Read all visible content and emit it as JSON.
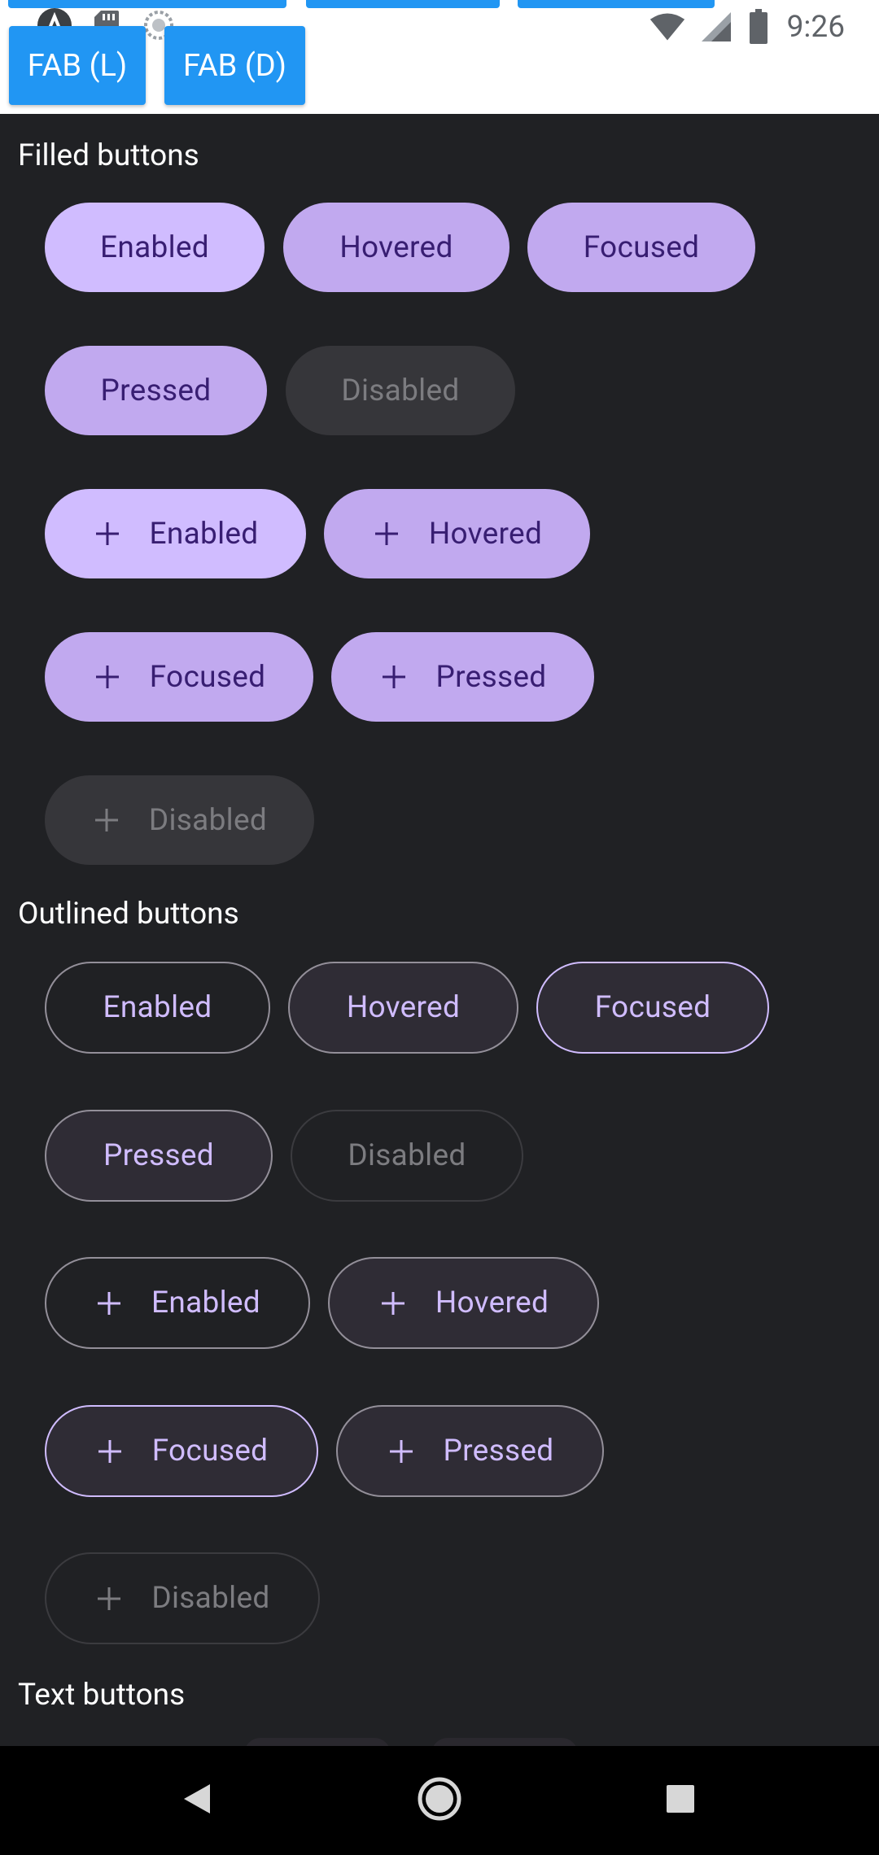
{
  "status_bar": {
    "time": "9:26",
    "left_icons": [
      "app-a-icon",
      "sd-card-icon",
      "sync-icon"
    ],
    "right_icons": [
      "wifi-icon",
      "cell-signal-icon",
      "battery-icon"
    ]
  },
  "top_actions": {
    "fab_light_label": "FAB (L)",
    "fab_dark_label": "FAB (D)"
  },
  "filled_section": {
    "title": "Filled buttons",
    "buttons": [
      {
        "label": "Enabled",
        "icon": null,
        "state": "enabled"
      },
      {
        "label": "Hovered",
        "icon": null,
        "state": "hovered"
      },
      {
        "label": "Focused",
        "icon": null,
        "state": "focused"
      },
      {
        "label": "Pressed",
        "icon": null,
        "state": "pressed"
      },
      {
        "label": "Disabled",
        "icon": null,
        "state": "disabled"
      },
      {
        "label": "Enabled",
        "icon": "plus-icon",
        "state": "enabled"
      },
      {
        "label": "Hovered",
        "icon": "plus-icon",
        "state": "hovered"
      },
      {
        "label": "Focused",
        "icon": "plus-icon",
        "state": "focused"
      },
      {
        "label": "Pressed",
        "icon": "plus-icon",
        "state": "pressed"
      },
      {
        "label": "Disabled",
        "icon": "plus-icon",
        "state": "disabled"
      }
    ]
  },
  "outlined_section": {
    "title": "Outlined buttons",
    "buttons": [
      {
        "label": "Enabled",
        "icon": null,
        "state": "enabled"
      },
      {
        "label": "Hovered",
        "icon": null,
        "state": "hovered"
      },
      {
        "label": "Focused",
        "icon": null,
        "state": "focused"
      },
      {
        "label": "Pressed",
        "icon": null,
        "state": "pressed"
      },
      {
        "label": "Disabled",
        "icon": null,
        "state": "disabled"
      },
      {
        "label": "Enabled",
        "icon": "plus-icon",
        "state": "enabled"
      },
      {
        "label": "Hovered",
        "icon": "plus-icon",
        "state": "hovered"
      },
      {
        "label": "Focused",
        "icon": "plus-icon",
        "state": "focused"
      },
      {
        "label": "Pressed",
        "icon": "plus-icon",
        "state": "pressed"
      },
      {
        "label": "Disabled",
        "icon": "plus-icon",
        "state": "disabled"
      }
    ]
  },
  "text_section": {
    "title": "Text buttons"
  },
  "nav_bar": {
    "icons": [
      "back-icon",
      "home-icon",
      "recents-icon"
    ]
  },
  "colors": {
    "accent_blue": "#2196f3",
    "background_dark": "#202124",
    "primary": "#d0bcff",
    "on_primary": "#381e72",
    "outline": "#938f99"
  }
}
